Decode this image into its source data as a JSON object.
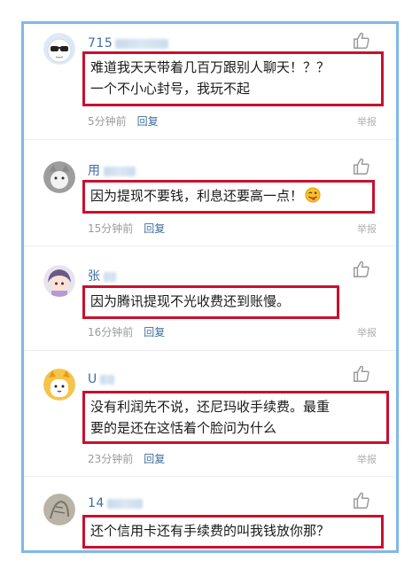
{
  "comments": [
    {
      "username": "715",
      "avatar": "sunglasses-avatar",
      "lines": [
        "难道我天天带着几百万跟别人聊天！？？",
        "一个不小心封号，我玩不起"
      ],
      "time": "5分钟前",
      "reply": "回复",
      "report": "举报"
    },
    {
      "username": "用",
      "avatar": "cat-avatar",
      "lines": [
        "因为提现不要钱，利息还要高一点！"
      ],
      "emoji": "winking-tongue-emoji",
      "time": "15分钟前",
      "reply": "回复",
      "report": "举报"
    },
    {
      "username": "张",
      "avatar": "anime-avatar",
      "lines": [
        "因为腾讯提现不光收费还到账慢。"
      ],
      "time": "16分钟前",
      "reply": "回复",
      "report": "举报"
    },
    {
      "username": "U",
      "avatar": "dog-avatar",
      "lines": [
        "没有利润先不说，还尼玛收手续费。最重",
        "要的是还在这恬着个脸问为什么"
      ],
      "time": "23分钟前",
      "reply": "回复",
      "report": "举报"
    },
    {
      "username": "14",
      "avatar": "sketch-avatar",
      "lines": [
        "还个信用卡还有手续费的叫我钱放你那？"
      ],
      "time": "",
      "reply": "",
      "report": ""
    }
  ],
  "colors": {
    "frame_border": "#7fb8e6",
    "highlight_box": "#c8102e",
    "username": "#3f6e9e",
    "meta": "#9a9a9a"
  }
}
